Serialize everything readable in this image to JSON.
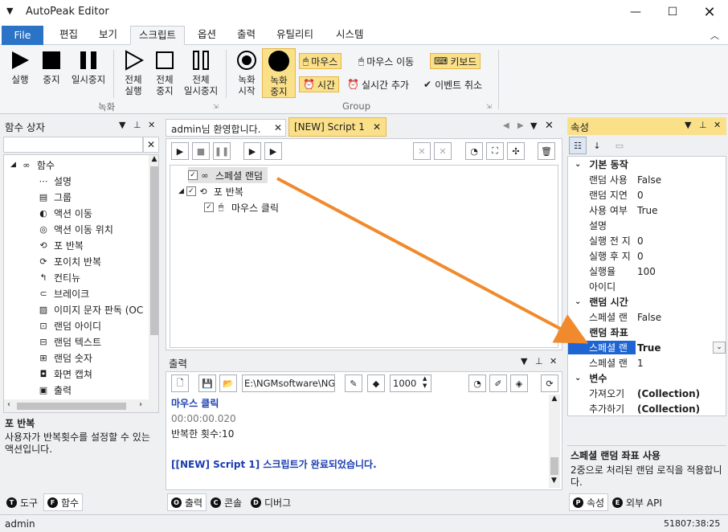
{
  "window": {
    "title": "AutoPeak Editor"
  },
  "menu": {
    "tabs": [
      "File",
      "편집",
      "보기",
      "스크립트",
      "옵션",
      "출력",
      "유틸리티",
      "시스템"
    ]
  },
  "ribbon": {
    "buttons": [
      "실행",
      "중지",
      "일시중지",
      "전체\n실행",
      "전체\n중지",
      "전체\n일시중지",
      "녹화\n시작",
      "녹화\n중지"
    ],
    "group_record": "녹화",
    "group_group": "Group",
    "small": {
      "mouse": "마우스",
      "mouse_move": "마우스 이동",
      "keyboard": "키보드",
      "time": "시간",
      "realtime_add": "실시간 추가",
      "event_cancel": "이벤트 취소"
    }
  },
  "left_panel": {
    "title": "함수 상자",
    "search_value": "",
    "root": "함수",
    "items": [
      "설명",
      "그룹",
      "액션 이동",
      "액션 이동 위치",
      "포 반복",
      "포이치 반복",
      "컨티뉴",
      "브레이크",
      "이미지 문자 판독 (OC",
      "랜덤 아이디",
      "랜덤 텍스트",
      "랜덤 숫자",
      "화면 캡쳐",
      "출력"
    ],
    "desc_title": "포 반복",
    "desc_text": "사용자가 반복횟수를 설정할 수 있는 액션입니다.",
    "tabs": [
      {
        "icon": "T",
        "label": "도구"
      },
      {
        "icon": "F",
        "label": "함수"
      }
    ]
  },
  "editor": {
    "tabs": [
      "admin님 환영합니다.",
      "[NEW] Script 1"
    ],
    "tree": [
      {
        "label": "스페셜 랜덤",
        "checked": "✓"
      },
      {
        "label": "포 반복",
        "checked": "✓"
      },
      {
        "label": "마우스 클릭",
        "checked": "✓"
      }
    ]
  },
  "output": {
    "title": "출력",
    "path": "E:\\NGMsoftware\\NG",
    "count": "1000",
    "lines": [
      "마우스 클릭",
      "00:00:00.020",
      "반복한 횟수:10",
      "",
      "[[NEW] Script 1] 스크립트가 완료되었습니다."
    ],
    "tabs": [
      {
        "icon": "O",
        "label": "출력"
      },
      {
        "icon": "C",
        "label": "콘솔"
      },
      {
        "icon": "D",
        "label": "디버그"
      }
    ]
  },
  "props": {
    "title": "속성",
    "cat_basic": "기본 동작",
    "basic": [
      [
        "랜덤 사용",
        "False"
      ],
      [
        "랜덤 지연",
        "0"
      ],
      [
        "사용 여부",
        "True"
      ],
      [
        "설명",
        ""
      ],
      [
        "실행 전 지",
        "0"
      ],
      [
        "실행 후 지",
        "0"
      ],
      [
        "실행율",
        "100"
      ],
      [
        "아이디",
        ""
      ]
    ],
    "cat_time": "랜덤 시간",
    "time": [
      [
        "스페셜 랜",
        "False"
      ]
    ],
    "cat_coord": "랜덤 좌표",
    "coord": [
      [
        "스페셜 랜",
        "True"
      ],
      [
        "스페셜 랜",
        "1"
      ]
    ],
    "cat_var": "변수",
    "vars": [
      [
        "가져오기",
        "(Collection)"
      ],
      [
        "추가하기",
        "(Collection)"
      ]
    ],
    "desc_title": "스페셜 랜덤 좌표 사용",
    "desc_text": "2중으로 처리된 랜덤 로직을 적용합니다.",
    "tabs": [
      {
        "icon": "P",
        "label": "속성"
      },
      {
        "icon": "E",
        "label": "외부 API"
      }
    ]
  },
  "status": {
    "user": "admin",
    "time": "51807:38:25"
  },
  "colors": {
    "file_tab": "#2b73c6",
    "highlight": "#fbe08a",
    "arrow": "#f08a2c",
    "selected": "#1e64d2"
  }
}
